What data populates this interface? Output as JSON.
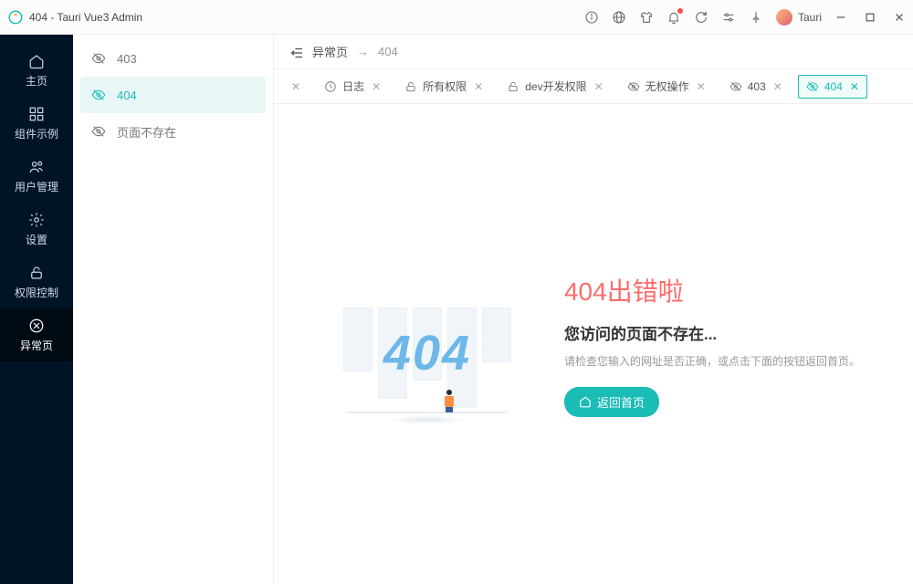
{
  "titlebar": {
    "title": "404 - Tauri Vue3 Admin",
    "username": "Tauri"
  },
  "sidebar": {
    "items": [
      {
        "label": "主页"
      },
      {
        "label": "组件示例"
      },
      {
        "label": "用户管理"
      },
      {
        "label": "设置"
      },
      {
        "label": "权限控制"
      },
      {
        "label": "异常页"
      }
    ],
    "activeIndex": 5
  },
  "submenu": {
    "items": [
      {
        "label": "403"
      },
      {
        "label": "404"
      },
      {
        "label": "页面不存在"
      }
    ],
    "activeIndex": 1
  },
  "breadcrumb": {
    "group": "异常页",
    "arrow": "→",
    "current": "404"
  },
  "tabs": {
    "items": [
      {
        "label": "",
        "icon": "none",
        "trunc": true
      },
      {
        "label": "日志",
        "icon": "clock"
      },
      {
        "label": "所有权限",
        "icon": "lock"
      },
      {
        "label": "dev开发权限",
        "icon": "lock"
      },
      {
        "label": "无权操作",
        "icon": "eye-off"
      },
      {
        "label": "403",
        "icon": "eye-off"
      },
      {
        "label": "404",
        "icon": "eye-off",
        "active": true
      }
    ]
  },
  "page404": {
    "big_number": "404",
    "title": "404出错啦",
    "subtitle": "您访问的页面不存在...",
    "desc": "请检查您输入的网址是否正确，或点击下面的按钮返回首页。",
    "button": "返回首页"
  }
}
